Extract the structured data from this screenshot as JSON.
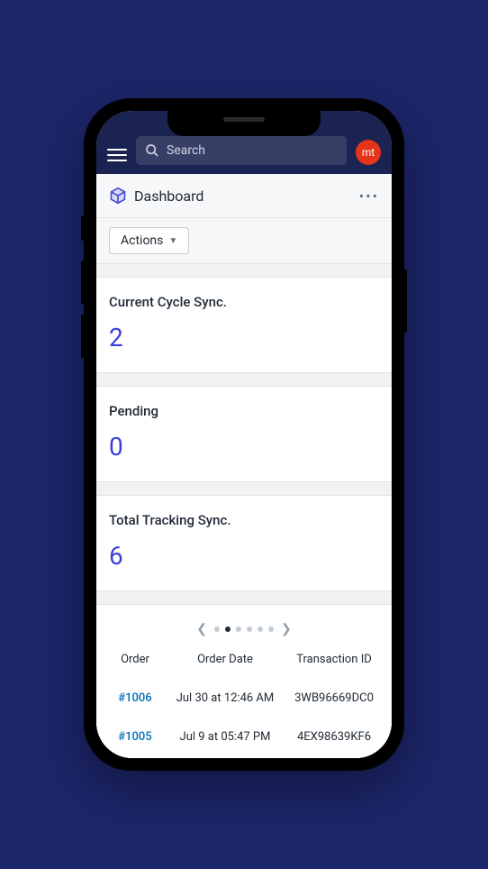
{
  "topbar": {
    "search_placeholder": "Search",
    "avatar_initials": "mt"
  },
  "header": {
    "title": "Dashboard"
  },
  "actions": {
    "label": "Actions"
  },
  "stats": [
    {
      "label": "Current Cycle Sync.",
      "value": "2"
    },
    {
      "label": "Pending",
      "value": "0"
    },
    {
      "label": "Total Tracking Sync.",
      "value": "6"
    }
  ],
  "pager": {
    "total_dots": 6,
    "active_index": 1
  },
  "table": {
    "headers": {
      "order": "Order",
      "date": "Order Date",
      "txn": "Transaction ID"
    },
    "rows": [
      {
        "order": "#1006",
        "date": "Jul 30 at 12:46 AM",
        "txn": "3WB96669DC0"
      },
      {
        "order": "#1005",
        "date": "Jul 9 at 05:47 PM",
        "txn": "4EX98639KF6"
      }
    ]
  },
  "colors": {
    "accent": "#3b3fd9",
    "link": "#006fbb",
    "navy": "#1a2351",
    "avatar": "#e63319"
  }
}
